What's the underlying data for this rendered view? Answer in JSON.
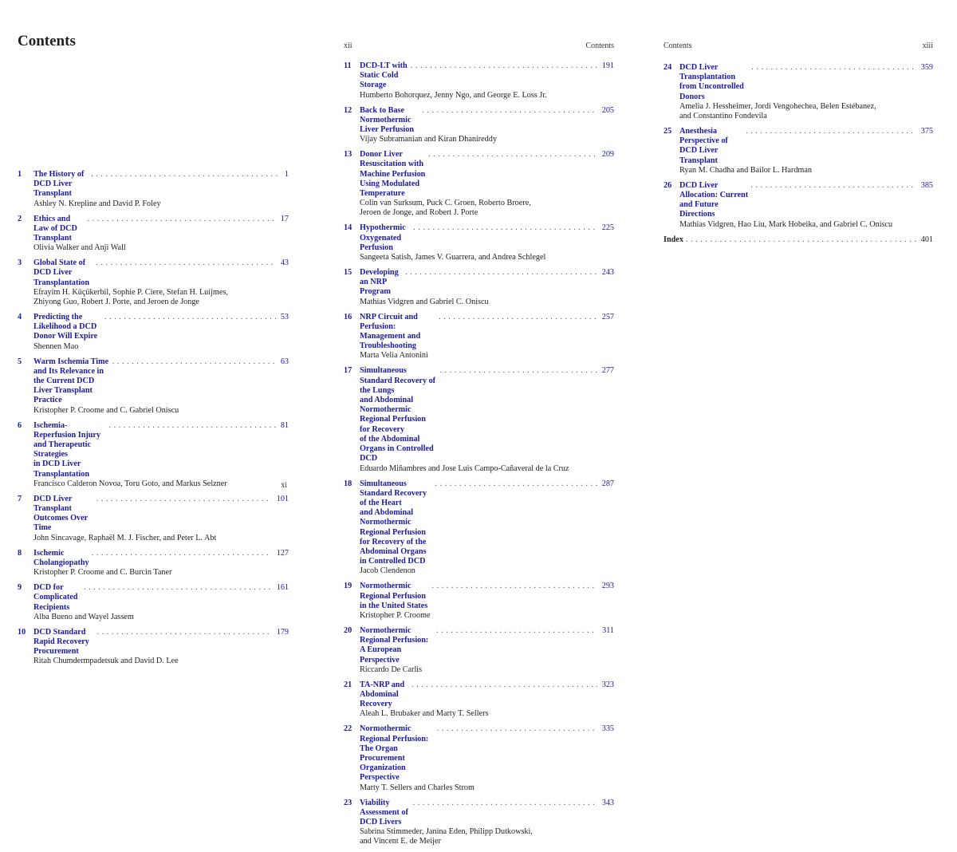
{
  "page_left": {
    "heading": "Contents",
    "folio": "xi",
    "entries": [
      {
        "num": "1",
        "title": "The History of DCD Liver Transplant",
        "page": "1",
        "authors": "Ashley N. Krepline and David P. Foley"
      },
      {
        "num": "2",
        "title": "Ethics and Law of DCD Transplant",
        "page": "17",
        "authors": "Olivia Walker and Anji Wall"
      },
      {
        "num": "3",
        "title": "Global State of DCD Liver Transplantation",
        "page": "43",
        "authors": "Efrayim H. Küçükerbil, Sophie P. Ciere, Stefan H. Luijmes,\nZhiyong Guo, Robert J. Porte, and Jeroen de Jonge"
      },
      {
        "num": "4",
        "title": "Predicting the Likelihood a DCD Donor Will Expire",
        "page": "53",
        "authors": "Shennen Mao"
      },
      {
        "num": "5",
        "title": "Warm Ischemia Time and Its Relevance in the Current DCD\nLiver Transplant Practice",
        "page": "63",
        "authors": "Kristopher P. Croome and C. Gabriel Oniscu"
      },
      {
        "num": "6",
        "title": "Ischemia-Reperfusion Injury and Therapeutic Strategies\nin DCD Liver Transplantation",
        "page": "81",
        "authors": "Francisco Calderon Novoa, Toru Goto, and Markus Selzner"
      },
      {
        "num": "7",
        "title": "DCD Liver Transplant Outcomes Over Time",
        "page": "101",
        "authors": "John Sincavage, Raphaël M. J. Fischer, and Peter L. Abt"
      },
      {
        "num": "8",
        "title": "Ischemic Cholangiopathy",
        "page": "127",
        "authors": "Kristopher P. Croome and C. Burcin Taner"
      },
      {
        "num": "9",
        "title": "DCD for Complicated Recipients",
        "page": "161",
        "authors": "Alba Bueno and Wayel Jassem"
      },
      {
        "num": "10",
        "title": "DCD Standard Rapid Recovery Procurement",
        "page": "179",
        "authors": "Ritah Chumdermpadetsuk and David D. Lee"
      }
    ]
  },
  "page_middle": {
    "running_left": "xii",
    "running_right": "Contents",
    "entries": [
      {
        "num": "11",
        "title": "DCD-LT with Static Cold Storage",
        "page": "191",
        "authors": "Humberto Bohorquez, Jenny Ngo, and George E. Loss Jr."
      },
      {
        "num": "12",
        "title": "Back to Base Normothermic Liver Perfusion",
        "page": "205",
        "authors": "Vijay Subramanian and Kiran Dhanireddy"
      },
      {
        "num": "13",
        "title": "Donor Liver Resuscitation with Machine Perfusion\nUsing Modulated Temperature",
        "page": "209",
        "authors": "Colin van Surksum, Puck C. Groen, Roberto Broere,\nJeroen de Jonge, and Robert J. Porte"
      },
      {
        "num": "14",
        "title": "Hypothermic Oxygenated Perfusion",
        "page": "225",
        "authors": "Sangeeta Satish, James V. Guarrera, and Andrea Schlegel"
      },
      {
        "num": "15",
        "title": "Developing an NRP Program",
        "page": "243",
        "authors": "Mathias Vidgren and Gabriel C. Oniscu"
      },
      {
        "num": "16",
        "title": "NRP Circuit and Perfusion: Management and Troubleshooting",
        "page": "257",
        "authors": "Marta Velia Antonini"
      },
      {
        "num": "17",
        "title": "Simultaneous Standard Recovery of the Lungs\nand Abdominal Normothermic Regional Perfusion for Recovery\nof the Abdominal Organs in Controlled DCD",
        "page": "277",
        "authors": "Eduardo Miñambres and Jose Luis Campo-Cañaveral de la Cruz"
      },
      {
        "num": "18",
        "title": "Simultaneous Standard Recovery of the Heart\nand Abdominal Normothermic Regional Perfusion\nfor Recovery of the Abdominal Organs in Controlled DCD",
        "page": "287",
        "authors": "Jacob Clendenon"
      },
      {
        "num": "19",
        "title": "Normothermic Regional Perfusion in the United States",
        "page": "293",
        "authors": "Kristopher P. Croome"
      },
      {
        "num": "20",
        "title": "Normothermic Regional Perfusion: A European Perspective",
        "page": "311",
        "authors": "Riccardo De Carlis"
      },
      {
        "num": "21",
        "title": "TA-NRP and Abdominal Recovery",
        "page": "323",
        "authors": "Aleah L. Brubaker and Marty T. Sellers"
      },
      {
        "num": "22",
        "title": "Normothermic Regional Perfusion: The Organ Procurement\nOrganization Perspective",
        "page": "335",
        "authors": "Marty T. Sellers and Charles Strom"
      },
      {
        "num": "23",
        "title": "Viability Assessment of DCD Livers",
        "page": "343",
        "authors": "Sabrina Stimmeder, Janina Eden, Philipp Dutkowski,\nand Vincent E. de Meijer"
      }
    ]
  },
  "page_right": {
    "running_left": "Contents",
    "running_right": "xiii",
    "entries": [
      {
        "num": "24",
        "title": "DCD Liver Transplantation from Uncontrolled Donors",
        "page": "359",
        "authors": "Amelia J. Hessheimer, Jordi Vengohechea, Belen Estébanez,\nand Constantino Fondevila"
      },
      {
        "num": "25",
        "title": "Anesthesia Perspective of DCD Liver Transplant",
        "page": "375",
        "authors": "Ryan M. Chadha and Bailor L. Hardman"
      },
      {
        "num": "26",
        "title": "DCD Liver Allocation: Current and Future Directions",
        "page": "385",
        "authors": "Mathias Vidgren, Hao Liu, Mark Hobeika, and Gabriel C. Oniscu"
      }
    ],
    "index": {
      "label": "Index",
      "page": "401"
    }
  },
  "colors": {
    "link_blue": "#1a1aa6",
    "text": "#222222"
  }
}
